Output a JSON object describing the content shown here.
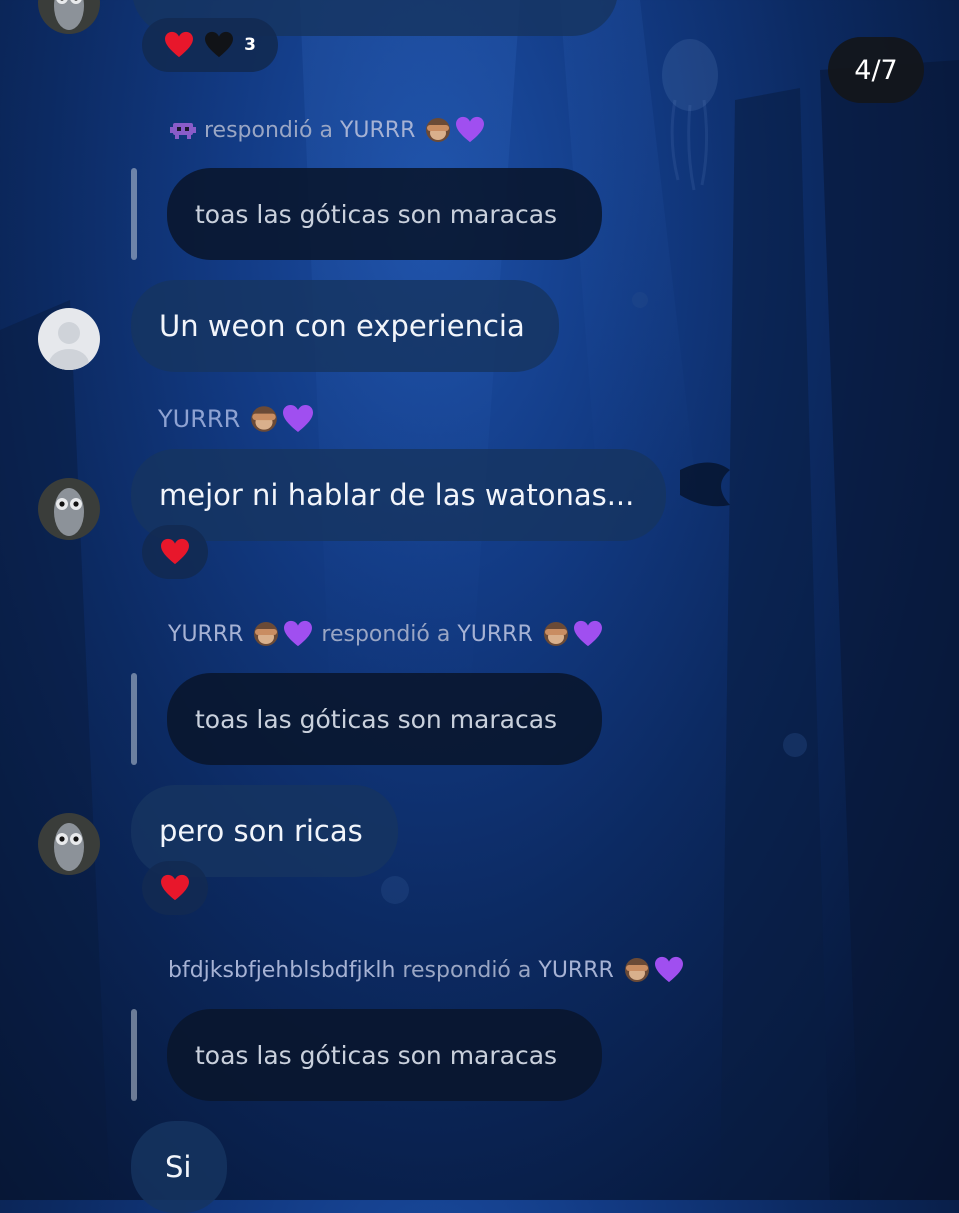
{
  "story_counter": "4/7",
  "top_message": {
    "reaction_count": "3"
  },
  "reply_1": {
    "action": "respondió a",
    "target": "YURRR",
    "quoted_text": "toas las góticas son maracas"
  },
  "message_1": {
    "text": "Un weon con experiencia"
  },
  "sender_1": {
    "name": "YURRR"
  },
  "message_2": {
    "text": "mejor ni hablar de las watonas..."
  },
  "reply_2": {
    "sender": "YURRR",
    "action": "respondió a",
    "target": "YURRR",
    "quoted_text": "toas las góticas son maracas"
  },
  "message_3": {
    "text": "pero son ricas"
  },
  "reply_3": {
    "sender": "bfdjksbfjehblsbdfjklh",
    "action": "respondió a",
    "target": "YURRR",
    "quoted_text": "toas las góticas son maracas"
  },
  "message_4": {
    "text": "Si"
  },
  "icons": {
    "heart": "red-heart-icon",
    "black_heart": "black-heart-icon",
    "purple_heart": "purple-heart-icon",
    "monkey": "see-no-evil-monkey-icon",
    "alien": "alien-monster-icon"
  },
  "colors": {
    "bubble": "#163460",
    "quoted_bubble": "#09162c",
    "reply_label": "#9aa6c4",
    "heart_red": "#e8172b",
    "heart_purple": "#a04ff0"
  }
}
